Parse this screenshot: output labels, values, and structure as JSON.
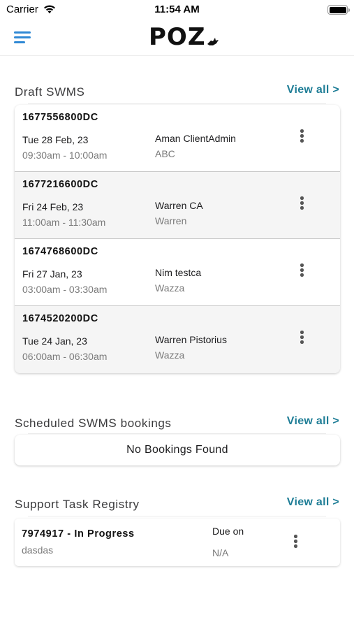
{
  "status_bar": {
    "carrier": "Carrier",
    "time": "11:54 AM",
    "battery_level": 1.0
  },
  "navbar": {
    "logo": "POZ",
    "menu_icon": "hamburger-menu-icon",
    "accent_color": "#2f88d4"
  },
  "draft_swms": {
    "title": "Draft SWMS",
    "view_all": "View all >",
    "items": [
      {
        "id": "1677556800DC",
        "date": "Tue 28 Feb, 23",
        "time": "09:30am - 10:00am",
        "user": "Aman ClientAdmin",
        "org": "ABC"
      },
      {
        "id": "1677216600DC",
        "date": "Fri 24 Feb, 23",
        "time": "11:00am - 11:30am",
        "user": "Warren CA",
        "org": "Warren"
      },
      {
        "id": "1674768600DC",
        "date": "Fri 27 Jan, 23",
        "time": "03:00am - 03:30am",
        "user": "Nim testca",
        "org": "Wazza"
      },
      {
        "id": "1674520200DC",
        "date": "Tue 24 Jan, 23",
        "time": "06:00am - 06:30am",
        "user": "Warren Pistorius",
        "org": "Wazza"
      }
    ]
  },
  "scheduled_bookings": {
    "title": "Scheduled SWMS bookings",
    "view_all": "View all >",
    "empty_message": "No Bookings Found"
  },
  "support_tasks": {
    "title": "Support Task Registry",
    "view_all": "View all >",
    "items": [
      {
        "title": "7974917 - In Progress",
        "subtitle": "dasdas",
        "due_label": "Due on",
        "due_value": "N/A"
      }
    ]
  },
  "colors": {
    "link": "#1e7d96",
    "menu": "#2f88d4",
    "muted_text": "#7a7a7a",
    "alt_row": "#f5f5f5"
  }
}
